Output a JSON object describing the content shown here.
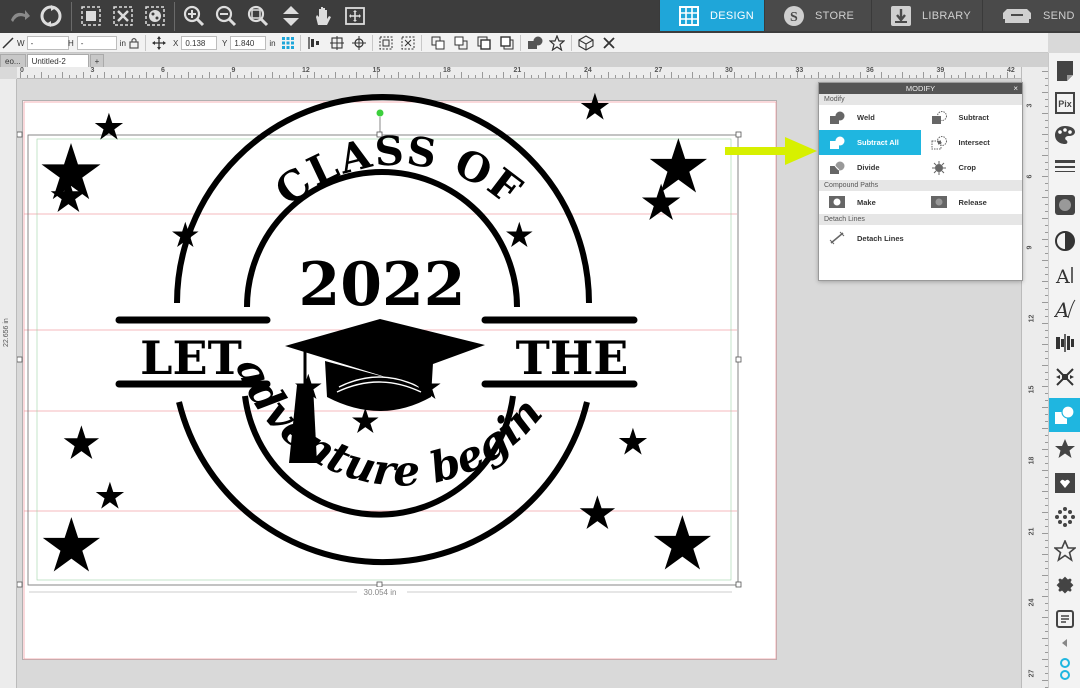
{
  "top_tabs": [
    {
      "label": "DESIGN",
      "icon": "grid-icon",
      "active": true
    },
    {
      "label": "STORE",
      "icon": "store-s-icon",
      "active": false
    },
    {
      "label": "LIBRARY",
      "icon": "library-download-icon",
      "active": false
    },
    {
      "label": "SEND",
      "icon": "cutter-send-icon",
      "active": false
    }
  ],
  "toolbar2": {
    "w_label": "W",
    "w_value": "-",
    "h_label": "H",
    "h_value": "-",
    "unit": "in",
    "x_label": "X",
    "x_value": "0.138",
    "y_label": "Y",
    "y_value": "1.840"
  },
  "doc_tabs": [
    {
      "label": "eo..."
    },
    {
      "label": "Untitled-2"
    },
    {
      "label": "+"
    }
  ],
  "ruler_top": [
    "0",
    "3",
    "6",
    "9",
    "12",
    "15",
    "18",
    "21",
    "24",
    "27",
    "30",
    "33",
    "36",
    "39",
    "42"
  ],
  "ruler_right": [
    "3",
    "6",
    "9",
    "12",
    "15",
    "18",
    "21",
    "24",
    "27"
  ],
  "ruler_left_label": "22.656 in",
  "selection": {
    "width_label": "30.054 in",
    "height_label": "22.656 in"
  },
  "design": {
    "top_text": "CLASS OF",
    "year": "2022",
    "left_word": "LET",
    "right_word": "THE",
    "script_text": "adventure begin"
  },
  "modify_panel": {
    "title": "MODIFY",
    "close": "×",
    "sections": [
      {
        "title": "Modify",
        "items": [
          {
            "label": "Weld",
            "icon": "weld-icon",
            "active": false
          },
          {
            "label": "Subtract",
            "icon": "subtract-icon",
            "active": false
          },
          {
            "label": "Subtract All",
            "icon": "subtract-all-icon",
            "active": true
          },
          {
            "label": "Intersect",
            "icon": "intersect-icon",
            "active": false
          },
          {
            "label": "Divide",
            "icon": "divide-icon",
            "active": false
          },
          {
            "label": "Crop",
            "icon": "crop-icon",
            "active": false
          }
        ]
      },
      {
        "title": "Compound Paths",
        "items": [
          {
            "label": "Make",
            "icon": "make-compound-icon",
            "active": false
          },
          {
            "label": "Release",
            "icon": "release-compound-icon",
            "active": false
          }
        ]
      },
      {
        "title": "Detach Lines",
        "items": [
          {
            "label": "Detach Lines",
            "icon": "detach-lines-icon",
            "active": false
          }
        ]
      }
    ]
  },
  "right_sidebar_icons": [
    "page-setup-icon",
    "pixscan-icon",
    "fill-palette-icon",
    "line-style-icon",
    "trace-icon",
    "transparency-icon",
    "text-style-icon",
    "sketch-text-icon",
    "align-icon",
    "replicate-icon",
    "modify-icon",
    "offset-star-icon",
    "image-effects-icon",
    "rhinestone-icon",
    "transform-icon",
    "puzzle-icon",
    "send-tool-icon"
  ],
  "arrow_color": "#d7f000",
  "accent_color": "#1fb6e0"
}
